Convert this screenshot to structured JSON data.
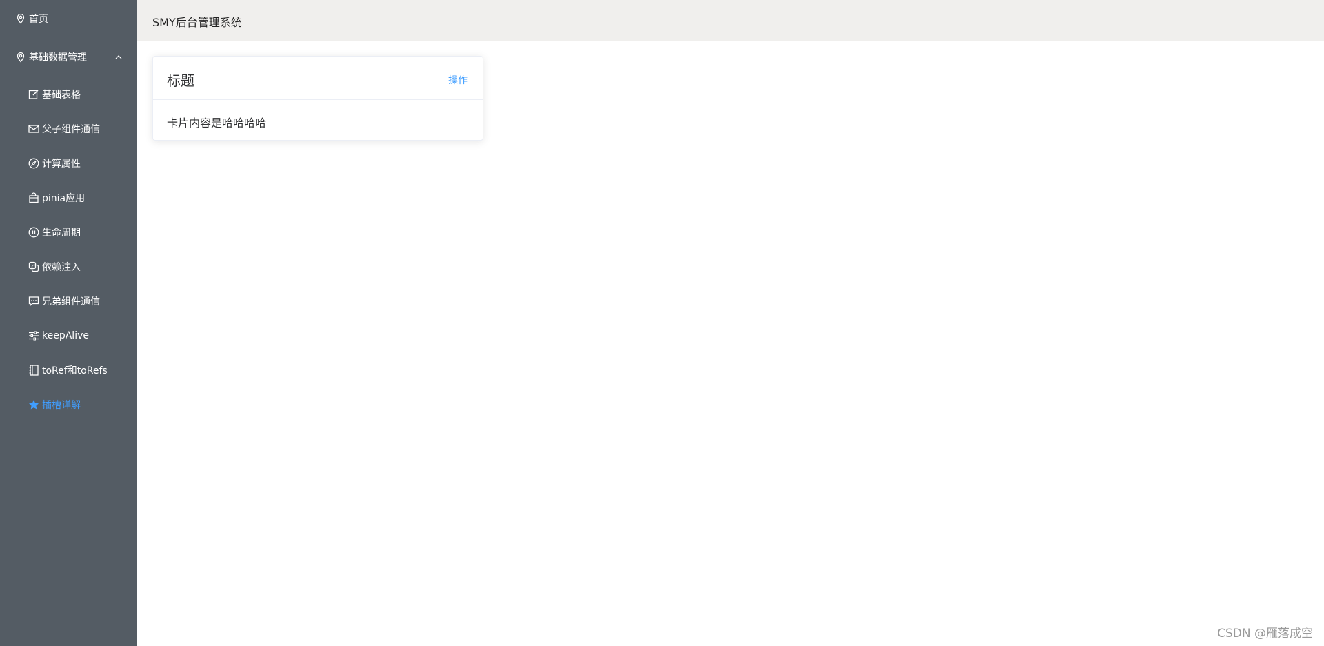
{
  "header": {
    "title": "SMY后台管理系统"
  },
  "sidebar": {
    "home": {
      "label": "首页",
      "icon": "location-icon"
    },
    "group": {
      "label": "基础数据管理",
      "icon": "location-icon",
      "expanded": true
    },
    "items": [
      {
        "label": "基础表格",
        "icon": "edit-icon"
      },
      {
        "label": "父子组件通信",
        "icon": "message-icon"
      },
      {
        "label": "计算属性",
        "icon": "compass-icon"
      },
      {
        "label": "pinia应用",
        "icon": "shopping-bag-icon"
      },
      {
        "label": "生命周期",
        "icon": "pause-circle-icon"
      },
      {
        "label": "依赖注入",
        "icon": "copy-icon"
      },
      {
        "label": "兄弟组件通信",
        "icon": "chat-dots-icon"
      },
      {
        "label": "keepAlive",
        "icon": "sliders-icon"
      },
      {
        "label": "toRef和toRefs",
        "icon": "notebook-icon"
      },
      {
        "label": "插槽详解",
        "icon": "star-icon",
        "active": true
      }
    ],
    "active_color": "#409eff",
    "background": "#545c64"
  },
  "card": {
    "title": "标题",
    "action": "操作",
    "body": "卡片内容是哈哈哈哈"
  },
  "watermark": "CSDN @雁落成空"
}
